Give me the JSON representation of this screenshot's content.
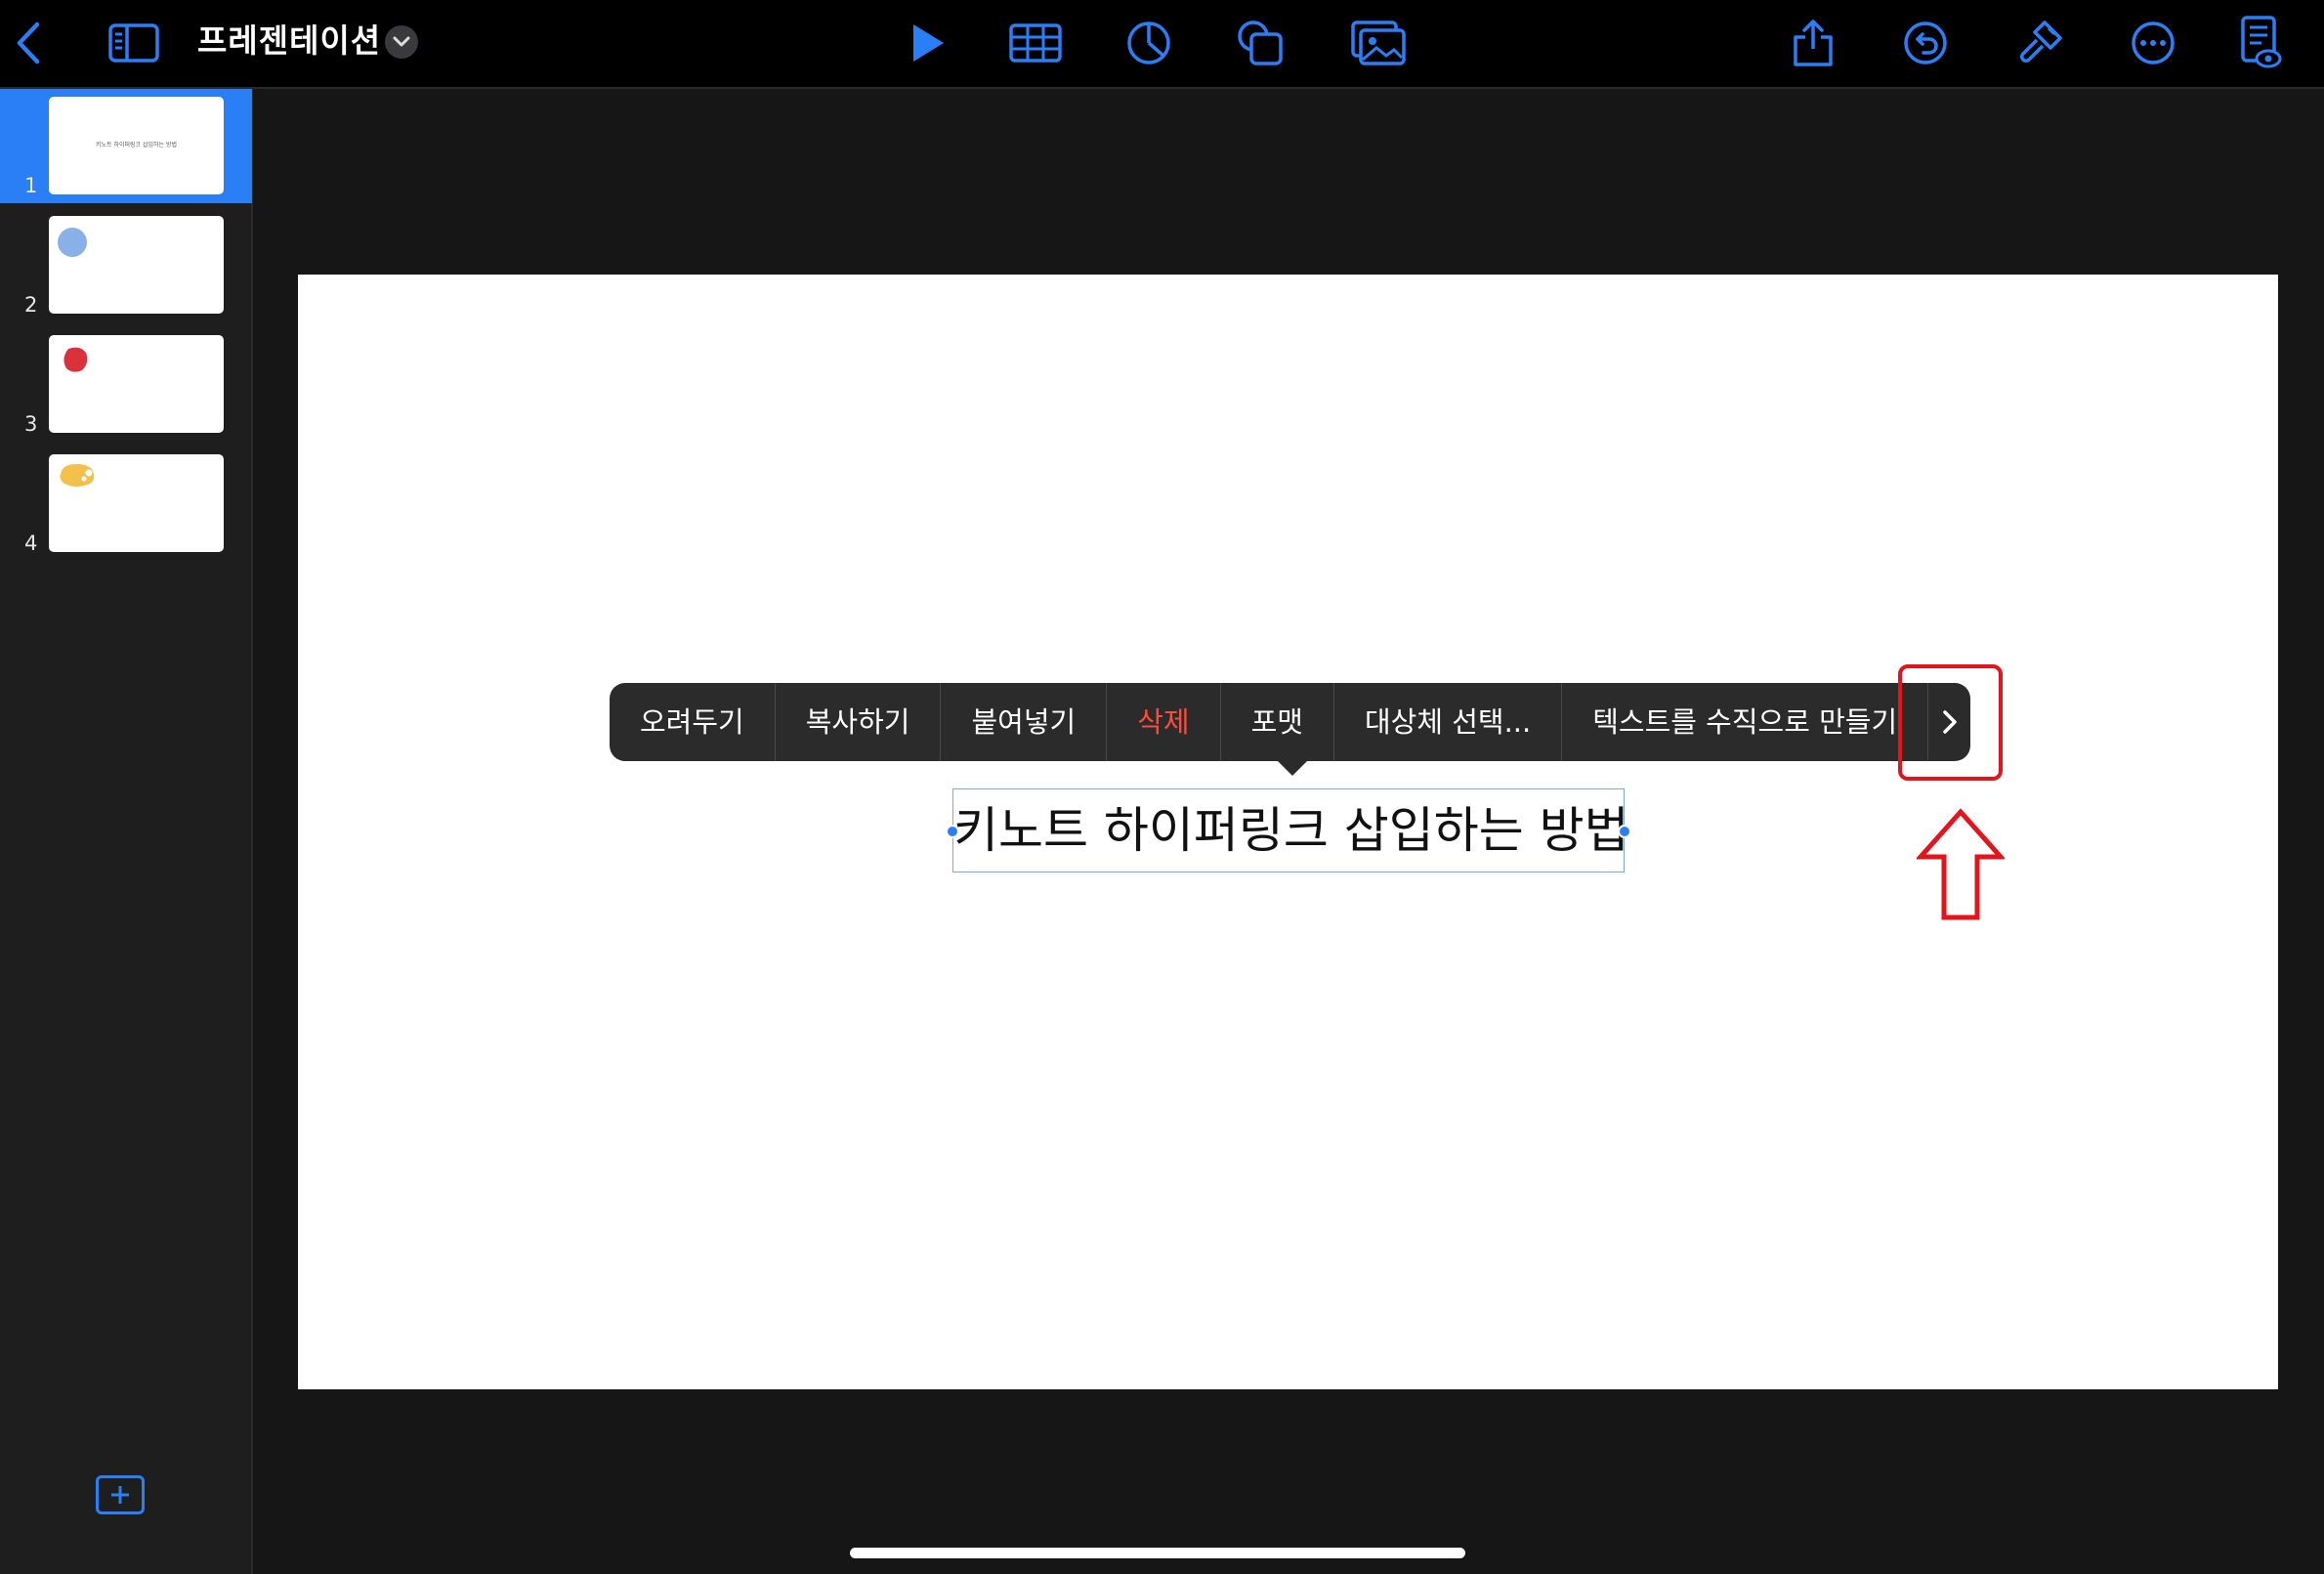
{
  "toolbar": {
    "title": "프레젠테이션",
    "icons": [
      "back-icon",
      "sidebar-icon",
      "play-icon",
      "table-icon",
      "chart-icon",
      "shapes-icon",
      "media-icon",
      "share-icon",
      "undo-icon",
      "format-brush-icon",
      "more-icon",
      "presenter-view-icon"
    ],
    "accent_color": "#2a7ff6"
  },
  "sidebar": {
    "slides": [
      {
        "number": "1",
        "text": "키노트 하이퍼링크 삽입하는 방법",
        "selected": true
      },
      {
        "number": "2",
        "shape": "circle",
        "shape_color": "#8ab0ea"
      },
      {
        "number": "3",
        "shape": "blob",
        "shape_color": "#d9323b"
      },
      {
        "number": "4",
        "shape": "blob",
        "shape_color": "#f3c04b"
      }
    ],
    "add_icon": "add-slide-icon"
  },
  "slide": {
    "text": "키노트 하이퍼링크 삽입하는 방법"
  },
  "context_menu": {
    "items": [
      "오려두기",
      "복사하기",
      "붙여넣기",
      "삭제",
      "포맷",
      "대상체 선택...",
      "텍스트를 수직으로 만들기"
    ],
    "more_icon": "chevron-right-icon",
    "destructive_color": "#ff4b3a"
  },
  "annotation": {
    "color": "#e3141c",
    "arrow_icon": "up-arrow-outline-icon"
  }
}
